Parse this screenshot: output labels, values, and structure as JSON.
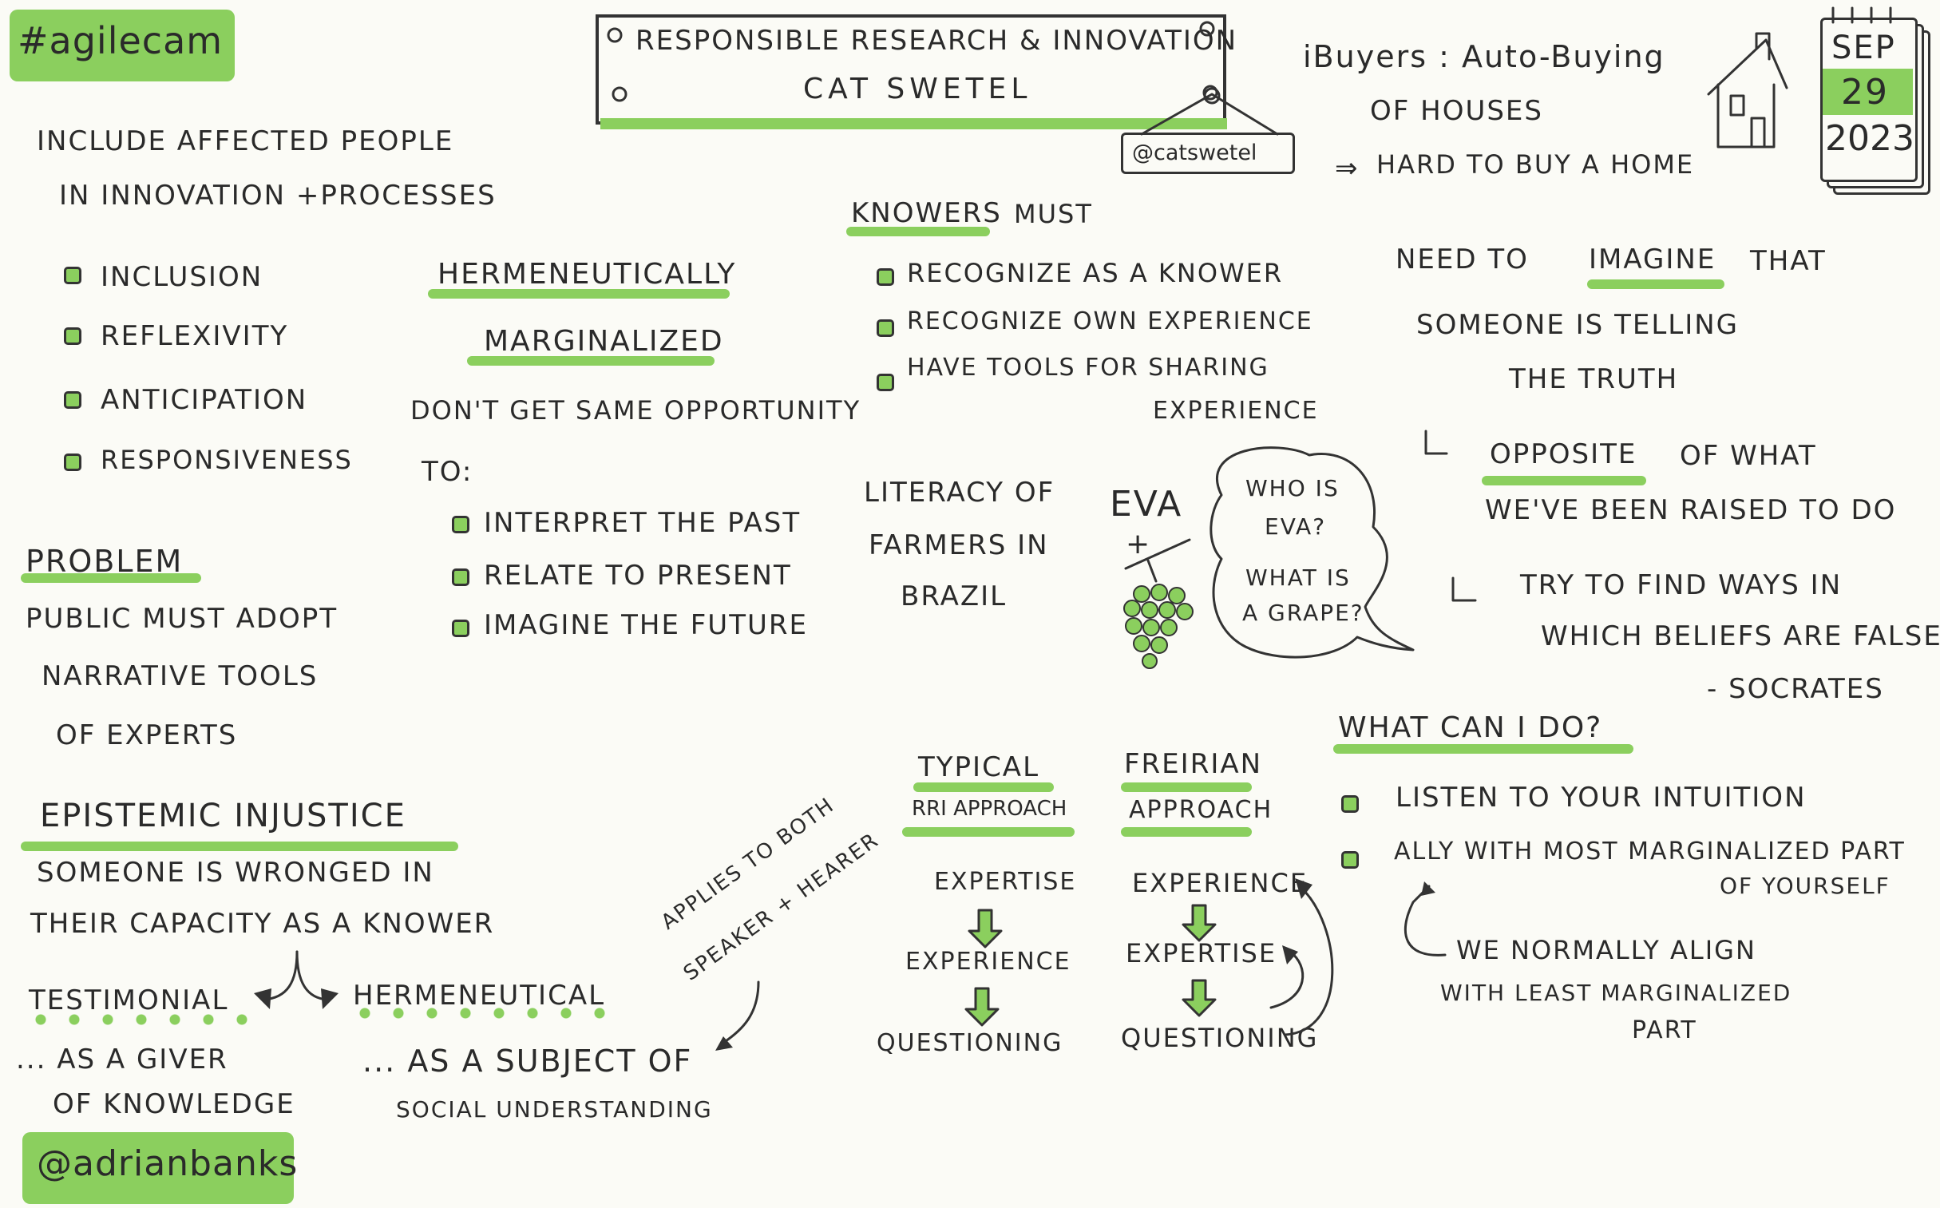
{
  "tags": {
    "conference": "#agilecam",
    "author": "@adrianbanks"
  },
  "header": {
    "title": "Responsible Research & Innovation",
    "speaker": "Cat Swetel",
    "handle": "@catswetel"
  },
  "date": {
    "month": "SEP",
    "day": "29",
    "year": "2023"
  },
  "ibuyers": {
    "line1": "iBuyers : Auto-Buying",
    "line2": "of houses",
    "line3": "Hard to buy a home"
  },
  "intro": {
    "line1": "Include affected people",
    "line2": "in innovation +processes"
  },
  "principles": [
    "Inclusion",
    "Reflexivity",
    "Anticipation",
    "Responsiveness"
  ],
  "problem": {
    "heading": "Problem",
    "lines": [
      "Public must adopt",
      "narrative tools",
      "of experts"
    ]
  },
  "epistemic": {
    "heading": "Epistemic Injustice",
    "lines": [
      "Someone is wronged in",
      "their capacity as a knower"
    ],
    "testimonial": "Testimonial",
    "hermeneutical": "Hermeneutical",
    "giver1": "... as a giver",
    "giver2": "of knowledge",
    "subject1": "... as a subject of",
    "subject2": "social understanding",
    "applies1": "Applies to both",
    "applies2": "speaker + hearer"
  },
  "marginalized": {
    "heading1": "Hermeneutically",
    "heading2": "Marginalized",
    "line1": "Don't get same opportunity",
    "line2": "to:",
    "items": [
      "Interpret the past",
      "Relate to present",
      "Imagine the future"
    ]
  },
  "knowers": {
    "heading": "Knowers",
    "suffix": "must",
    "items": [
      "Recognize as a knower",
      "Recognize own experience",
      "Have tools for sharing"
    ],
    "item3b": "experience"
  },
  "literacy": {
    "lines": [
      "Literacy of",
      "farmers in",
      "Brazil"
    ],
    "eva": "EVA",
    "plus": "+",
    "bubble1a": "Who is",
    "bubble1b": "Eva?",
    "bubble2a": "What is",
    "bubble2b": "a grape?"
  },
  "imagine": {
    "line1a": "Need to",
    "line1b": "imagine",
    "line1c": "that",
    "line2": "someone is telling",
    "line3": "the truth",
    "opp_a": "Opposite",
    "opp_b": "of what",
    "opp2": "we've been raised to do",
    "try1": "Try to find ways in",
    "try2": "which beliefs are false",
    "try3": "- Socrates"
  },
  "approaches": {
    "typical1": "Typical",
    "typical2": "RRI Approach",
    "freirian1": "Freirian",
    "freirian2": "Approach",
    "typical_steps": [
      "Expertise",
      "Experience",
      "Questioning"
    ],
    "freirian_steps": [
      "Experience",
      "Expertise",
      "Questioning"
    ]
  },
  "whatcan": {
    "heading": "What can I do?",
    "items": [
      "Listen to your intuition",
      "Ally with most marginalized part"
    ],
    "item2b": "of yourself",
    "note1": "We normally align",
    "note2": "with least marginalized",
    "note3": "part"
  },
  "colors": {
    "accent": "#8bcf5e",
    "ink": "#2a2a2a",
    "paper": "#fbfbf6"
  }
}
